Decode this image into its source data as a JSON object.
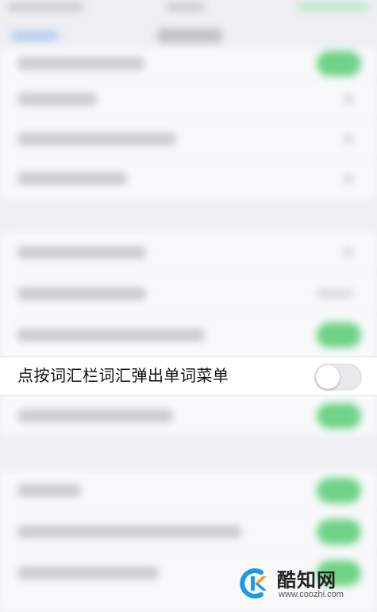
{
  "settings": {
    "focused_row": {
      "label": "点按词汇栏词汇弹出单词菜单",
      "toggle_state": "off"
    }
  },
  "colors": {
    "switch_on": "#6fd387",
    "switch_off": "#e9e9eb",
    "watermark_blue": "#1e9be0",
    "watermark_orange": "#f39a1e"
  },
  "watermark": {
    "title": "酷知网",
    "url": "www.coozhi.com",
    "logo_icon": "coozhi-logo-icon"
  }
}
